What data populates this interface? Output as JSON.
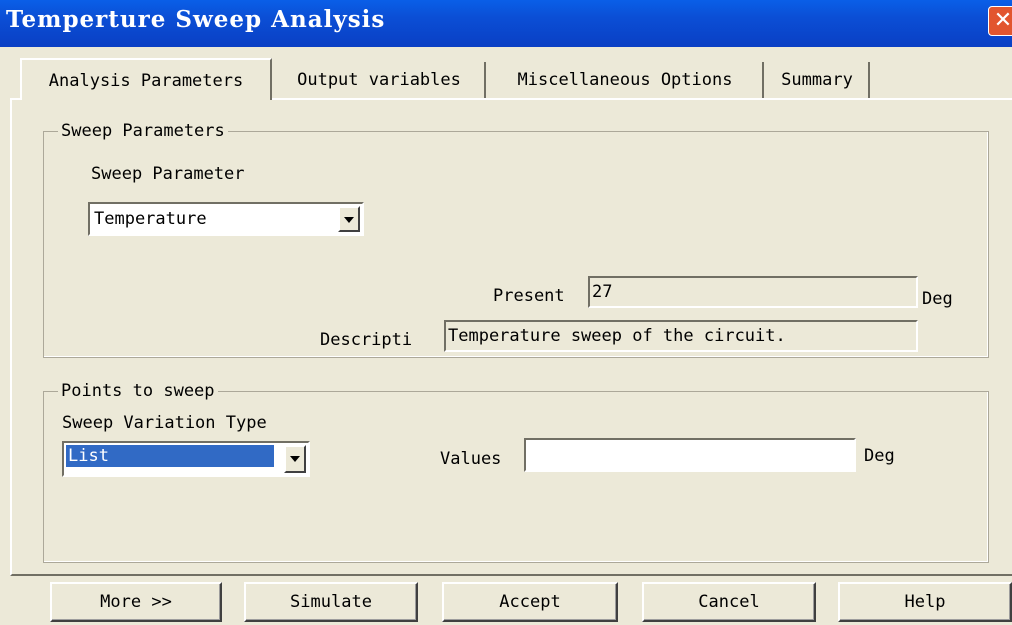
{
  "window": {
    "title": "Temperture Sweep Analysis",
    "close_glyph": "✕"
  },
  "tabs": [
    {
      "label": "Analysis Parameters",
      "active": true
    },
    {
      "label": "Output variables",
      "active": false
    },
    {
      "label": "Miscellaneous Options",
      "active": false
    },
    {
      "label": "Summary",
      "active": false
    }
  ],
  "sweep_parameters": {
    "group_label": "Sweep Parameters",
    "param_label": "Sweep Parameter",
    "param_value": "Temperature",
    "present_label": "Present",
    "present_value": "27",
    "present_unit": "Deg",
    "description_label": "Descripti",
    "description_value": "Temperature sweep of the circuit."
  },
  "points_to_sweep": {
    "group_label": "Points to sweep",
    "variation_label": "Sweep Variation Type",
    "variation_value": "List",
    "values_label": "Values",
    "values_value": "",
    "values_unit": "Deg"
  },
  "buttons": {
    "more": "More >>",
    "simulate": "Simulate",
    "accept": "Accept",
    "cancel": "Cancel",
    "help": "Help"
  },
  "icons": {
    "close": "close-icon",
    "dropdown": "chevron-down-icon"
  },
  "colors": {
    "titlebar": "#0a4fd6",
    "dialog_bg": "#ece9d8",
    "selection": "#316ac5",
    "close_button": "#e2552e"
  }
}
